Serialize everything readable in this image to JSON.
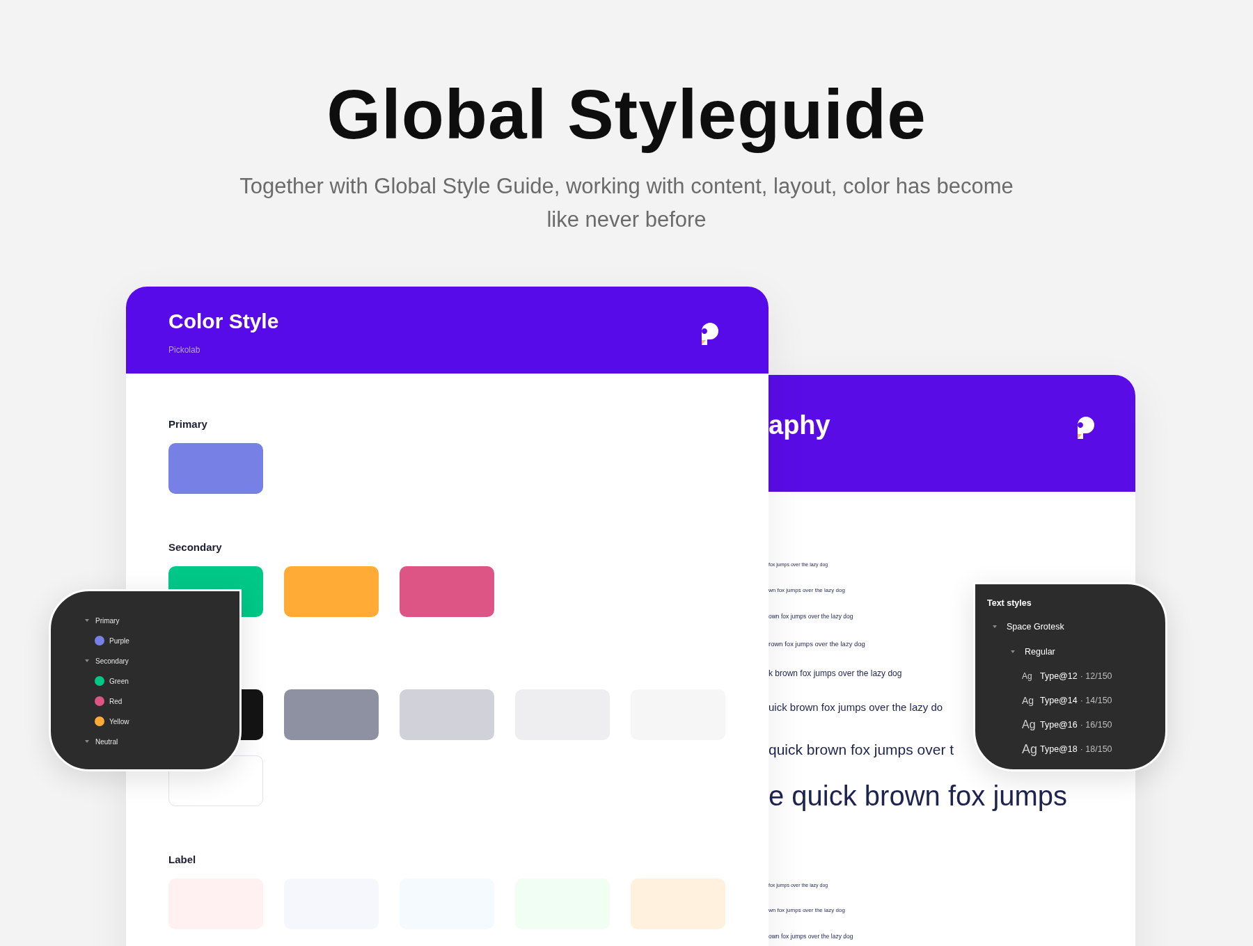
{
  "hero": {
    "title": "Global Styleguide",
    "subtitle": "Together with Global Style Guide, working with content, layout, color has become like never before"
  },
  "color_card": {
    "title": "Color Style",
    "subtitle": "Pickolab",
    "sections": [
      {
        "label": "Primary",
        "swatches": [
          {
            "color": "#7780e4"
          }
        ]
      },
      {
        "label": "Secondary",
        "swatches": [
          {
            "color": "#00c886"
          },
          {
            "color": "#ffab36"
          },
          {
            "color": "#dc5584"
          }
        ]
      },
      {
        "swatches": [
          {
            "color": "#141414"
          },
          {
            "color": "#8e91a2"
          },
          {
            "color": "#d0d1d9"
          },
          {
            "color": "#eeeef0"
          },
          {
            "color": "#f6f6f7"
          },
          {
            "color": "#ffffff"
          }
        ]
      },
      {
        "label": "Label",
        "swatches": [
          {
            "color": "#fff1f1"
          },
          {
            "color": "#f5f7fc"
          },
          {
            "color": "#f5fafe"
          },
          {
            "color": "#f1fef3"
          },
          {
            "color": "#fff1dd"
          }
        ]
      }
    ]
  },
  "typography_card": {
    "title": "aphy",
    "samples": [
      "fox jumps over the lazy dog",
      "wn fox jumps over the lazy dog",
      "own fox jumps over the lazy dog",
      "rown fox jumps over the lazy dog",
      "k brown fox jumps over the lazy dog",
      "uick brown fox jumps over the lazy do",
      "quick brown fox jumps over t",
      "e quick brown fox jumps"
    ],
    "samples_2": [
      "fox jumps over the lazy dog",
      "wn fox jumps over the lazy dog",
      "own fox jumps over the lazy dog"
    ]
  },
  "color_styles_panel": {
    "items": [
      {
        "label": "Primary",
        "expanded": true,
        "children": [
          {
            "label": "Purple",
            "color": "#7780e4"
          }
        ]
      },
      {
        "label": "Secondary",
        "expanded": true,
        "children": [
          {
            "label": "Green",
            "color": "#00c886"
          },
          {
            "label": "Red",
            "color": "#dc5584"
          },
          {
            "label": "Yellow",
            "color": "#ffab36"
          }
        ]
      },
      {
        "label": "Neutral",
        "expanded": true
      }
    ]
  },
  "text_styles_panel": {
    "title": "Text styles",
    "items": [
      {
        "label": "Space Grotesk",
        "expanded": true,
        "children": [
          {
            "label": "Regular",
            "expanded": true,
            "children": [
              {
                "glyph": "Ag",
                "name": "Type@12",
                "spec": "· 12/150"
              },
              {
                "glyph": "Ag",
                "name": "Type@14",
                "spec": "· 14/150"
              },
              {
                "glyph": "Ag",
                "name": "Type@16",
                "spec": "· 16/150"
              },
              {
                "glyph": "Ag",
                "name": "Type@18",
                "spec": "· 18/150"
              }
            ]
          }
        ]
      }
    ]
  }
}
